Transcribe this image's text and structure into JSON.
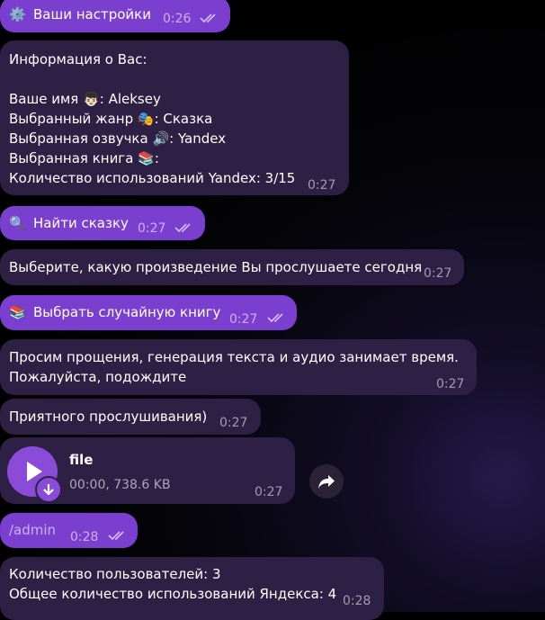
{
  "messages": {
    "settings": {
      "icon": "⚙️",
      "text": "Ваши настройки",
      "time": "0:26"
    },
    "info": {
      "title": "Информация о Вас:",
      "name_label": "Ваше имя ",
      "name_emoji": "👦🏻",
      "name_value": ": Aleksey",
      "genre_label": "Выбранный жанр ",
      "genre_emoji": "🎭",
      "genre_value": ": Сказка",
      "voice_label": "Выбранная озвучка ",
      "voice_emoji": "🔊",
      "voice_value": ": Yandex",
      "book_label": "Выбранная книга ",
      "book_emoji": "📚",
      "book_value": ":",
      "usage": "Количество использований Yandex: 3/15",
      "time": "0:27"
    },
    "find": {
      "icon": "🔍",
      "text": "Найти сказку",
      "time": "0:27"
    },
    "choose": {
      "text": "Выберите, какую произведение Вы прослушаете сегодня",
      "time": "0:27"
    },
    "random": {
      "icon": "📚",
      "text": "Выбрать случайную книгу",
      "time": "0:27"
    },
    "sorry": {
      "line1": "Просим прощения, генерация текста и аудио занимает время.",
      "line2": "Пожалуйста, подождите",
      "time": "0:27"
    },
    "enjoy": {
      "text": "Приятного прослушивания)",
      "time": "0:27"
    },
    "audio": {
      "title": "file",
      "meta": "00:00, 738.6 KB",
      "time": "0:27"
    },
    "admin": {
      "text": "/admin",
      "time": "0:28"
    },
    "stats": {
      "line1": "Количество пользователей: 3",
      "line2": "Общее количество использований Яндекса: 4",
      "time": "0:28"
    }
  },
  "colors": {
    "outgoing_bubble": "#7b3fd0",
    "incoming_bubble": "#2e1f45",
    "accent": "#8a4bd8"
  },
  "icons": [
    "gear-icon",
    "search-icon",
    "books-icon",
    "play-icon",
    "download-icon",
    "forward-icon",
    "double-check-icon"
  ]
}
